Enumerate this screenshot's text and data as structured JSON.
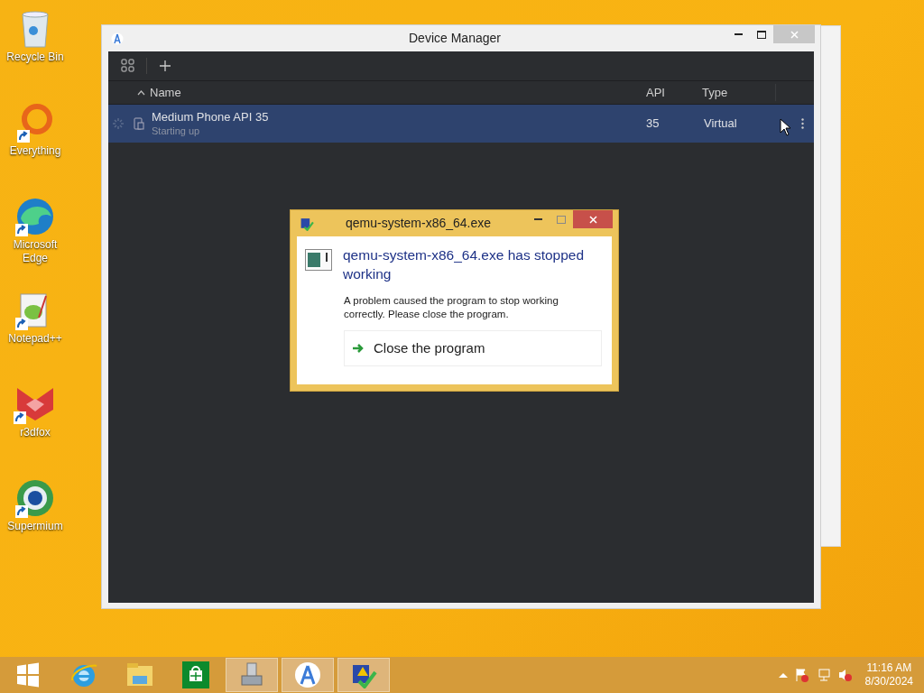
{
  "desktop_icons": [
    {
      "label": "Recycle Bin",
      "kind": "bin",
      "shortcut": false
    },
    {
      "label": "Everything",
      "kind": "ring",
      "shortcut": true
    },
    {
      "label": "Microsoft Edge",
      "kind": "wave",
      "shortcut": true
    },
    {
      "label": "Notepad++",
      "kind": "notepad",
      "shortcut": true
    },
    {
      "label": "r3dfox",
      "kind": "fox",
      "shortcut": true
    },
    {
      "label": "Supermium",
      "kind": "globe",
      "shortcut": true
    }
  ],
  "device_manager": {
    "title": "Device Manager",
    "columns": [
      "Name",
      "API",
      "Type"
    ],
    "rows": [
      {
        "name": "Medium Phone API 35",
        "status": "Starting up",
        "api": "35",
        "type": "Virtual",
        "selected": true
      }
    ]
  },
  "dialog": {
    "title": "qemu-system-x86_64.exe",
    "heading": "qemu-system-x86_64.exe has stopped working",
    "message": "A problem caused the program to stop working correctly. Please close the program.",
    "action": "Close the program"
  },
  "taskbar": {
    "items": [
      {
        "kind": "start",
        "active": false
      },
      {
        "kind": "browser",
        "active": false
      },
      {
        "kind": "folder",
        "active": false
      },
      {
        "kind": "store",
        "active": false
      },
      {
        "kind": "computer",
        "active": true
      },
      {
        "kind": "studio",
        "active": true
      },
      {
        "kind": "report",
        "active": true
      }
    ],
    "time": "11:16 AM",
    "date": "8/30/2024"
  }
}
